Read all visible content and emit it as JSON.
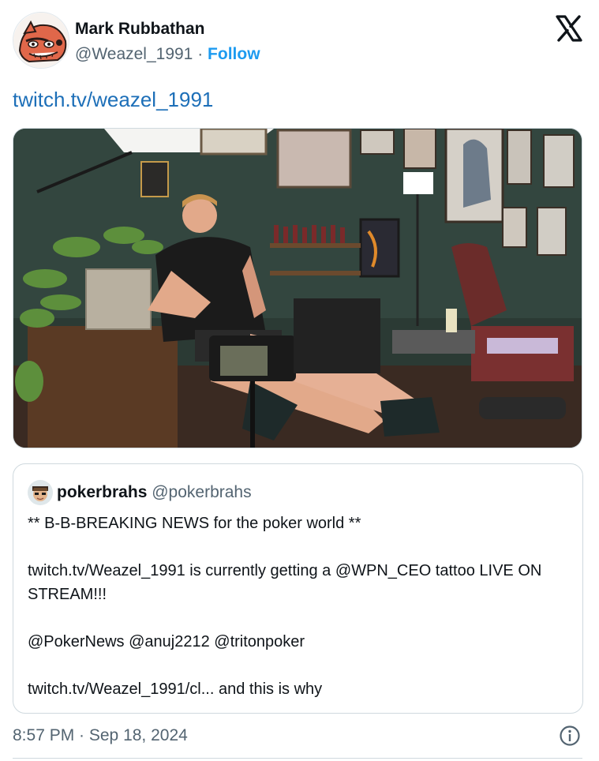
{
  "author": {
    "name": "Mark Rubbathan",
    "handle": "@Weazel_1991",
    "separator": "·",
    "follow_label": "Follow",
    "avatar_icon": "cartoon-weasel-avatar"
  },
  "brand_icon": "x-logo-icon",
  "post": {
    "link_text": "twitch.tv/weazel_1991",
    "media_icon": "photo-tattoo-studio"
  },
  "quote": {
    "name": "pokerbrahs",
    "handle": "@pokerbrahs",
    "paragraphs": [
      "** B-B-BREAKING NEWS for the poker world **",
      "twitch.tv/Weazel_1991 is currently getting a @WPN_CEO tattoo LIVE ON STREAM!!!",
      "@PokerNews @anuj2212 @tritonpoker",
      "twitch.tv/Weazel_1991/cl... and this is why"
    ]
  },
  "footer": {
    "timestamp": "8:57 PM · Sep 18, 2024",
    "info_icon": "info-icon"
  },
  "colors": {
    "link": "#1d6fb8",
    "follow": "#1d9bf0",
    "secondary_text": "#536471",
    "border": "#cfd9de"
  }
}
